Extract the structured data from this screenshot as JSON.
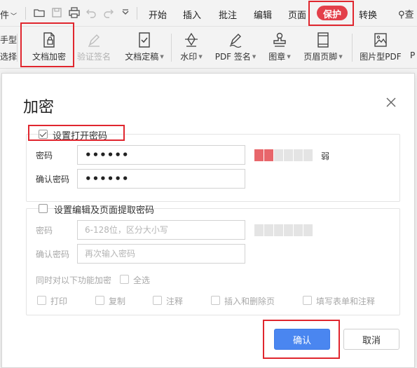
{
  "toolbar": {
    "file_menu": "件",
    "tabs": [
      "开始",
      "插入",
      "批注",
      "编辑",
      "页面",
      "保护",
      "转换"
    ],
    "active_tab": "保护",
    "search_cut": "查"
  },
  "ribbon": {
    "cut_labels": [
      "手型",
      "选择"
    ],
    "items": [
      {
        "label": "文档加密",
        "icon": "document-lock-icon",
        "enabled": true
      },
      {
        "label": "验证签名",
        "icon": "pen-verify-icon",
        "enabled": false
      },
      {
        "label": "文档定稿",
        "icon": "document-check-icon",
        "enabled": true
      },
      {
        "label": "水印",
        "icon": "watermark-icon",
        "enabled": true
      },
      {
        "label": "PDF 签名",
        "icon": "pdf-sign-icon",
        "enabled": true
      },
      {
        "label": "图章",
        "icon": "stamp-icon",
        "enabled": true
      },
      {
        "label": "页眉页脚",
        "icon": "header-footer-icon",
        "enabled": true
      },
      {
        "label": "图片型PDF",
        "icon": "image-pdf-icon",
        "enabled": true
      }
    ],
    "cut_right": "P"
  },
  "dialog": {
    "title": "加密",
    "open_password": {
      "checkbox_label": "设置打开密码",
      "checked": true,
      "password_label": "密码",
      "password_value": "••••••",
      "confirm_label": "确认密码",
      "confirm_value": "••••••",
      "strength_label": "弱",
      "strength_level": 2,
      "strength_total": 6
    },
    "edit_password": {
      "checkbox_label": "设置编辑及页面提取密码",
      "checked": false,
      "password_label": "密码",
      "password_placeholder": "6-128位，区分大小写",
      "confirm_label": "确认密码",
      "confirm_placeholder": "再次输入密码",
      "strength_total": 6,
      "encrypt_features_label": "同时对以下功能加密",
      "select_all_label": "全选",
      "features": [
        "打印",
        "复制",
        "注释",
        "插入和删除页",
        "填写表单和注释"
      ]
    },
    "confirm_button": "确认",
    "cancel_button": "取消"
  }
}
